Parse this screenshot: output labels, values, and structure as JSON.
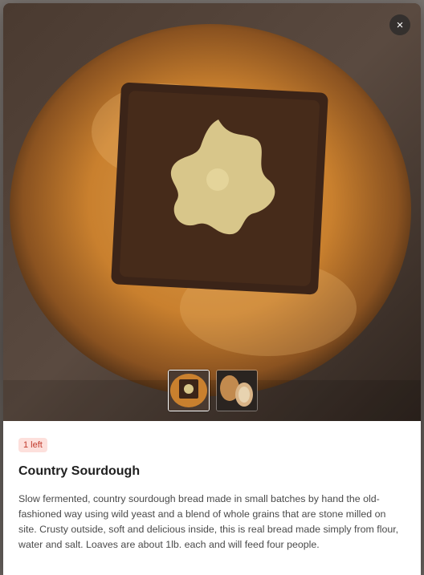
{
  "modal": {
    "close_icon": "×",
    "stock_badge": "1 left",
    "title": "Country Sourdough",
    "description": "Slow fermented, country sourdough bread made in small batches by hand the old-fashioned way using wild yeast and a blend of whole grains that are stone milled on site. Crusty outside, soft and delicious inside, this is real bread made simply from flour, water and salt. Loaves are about 1lb. each and will feed four people."
  },
  "colors": {
    "badge_bg": "#fde0dc",
    "badge_text": "#c0392b"
  }
}
